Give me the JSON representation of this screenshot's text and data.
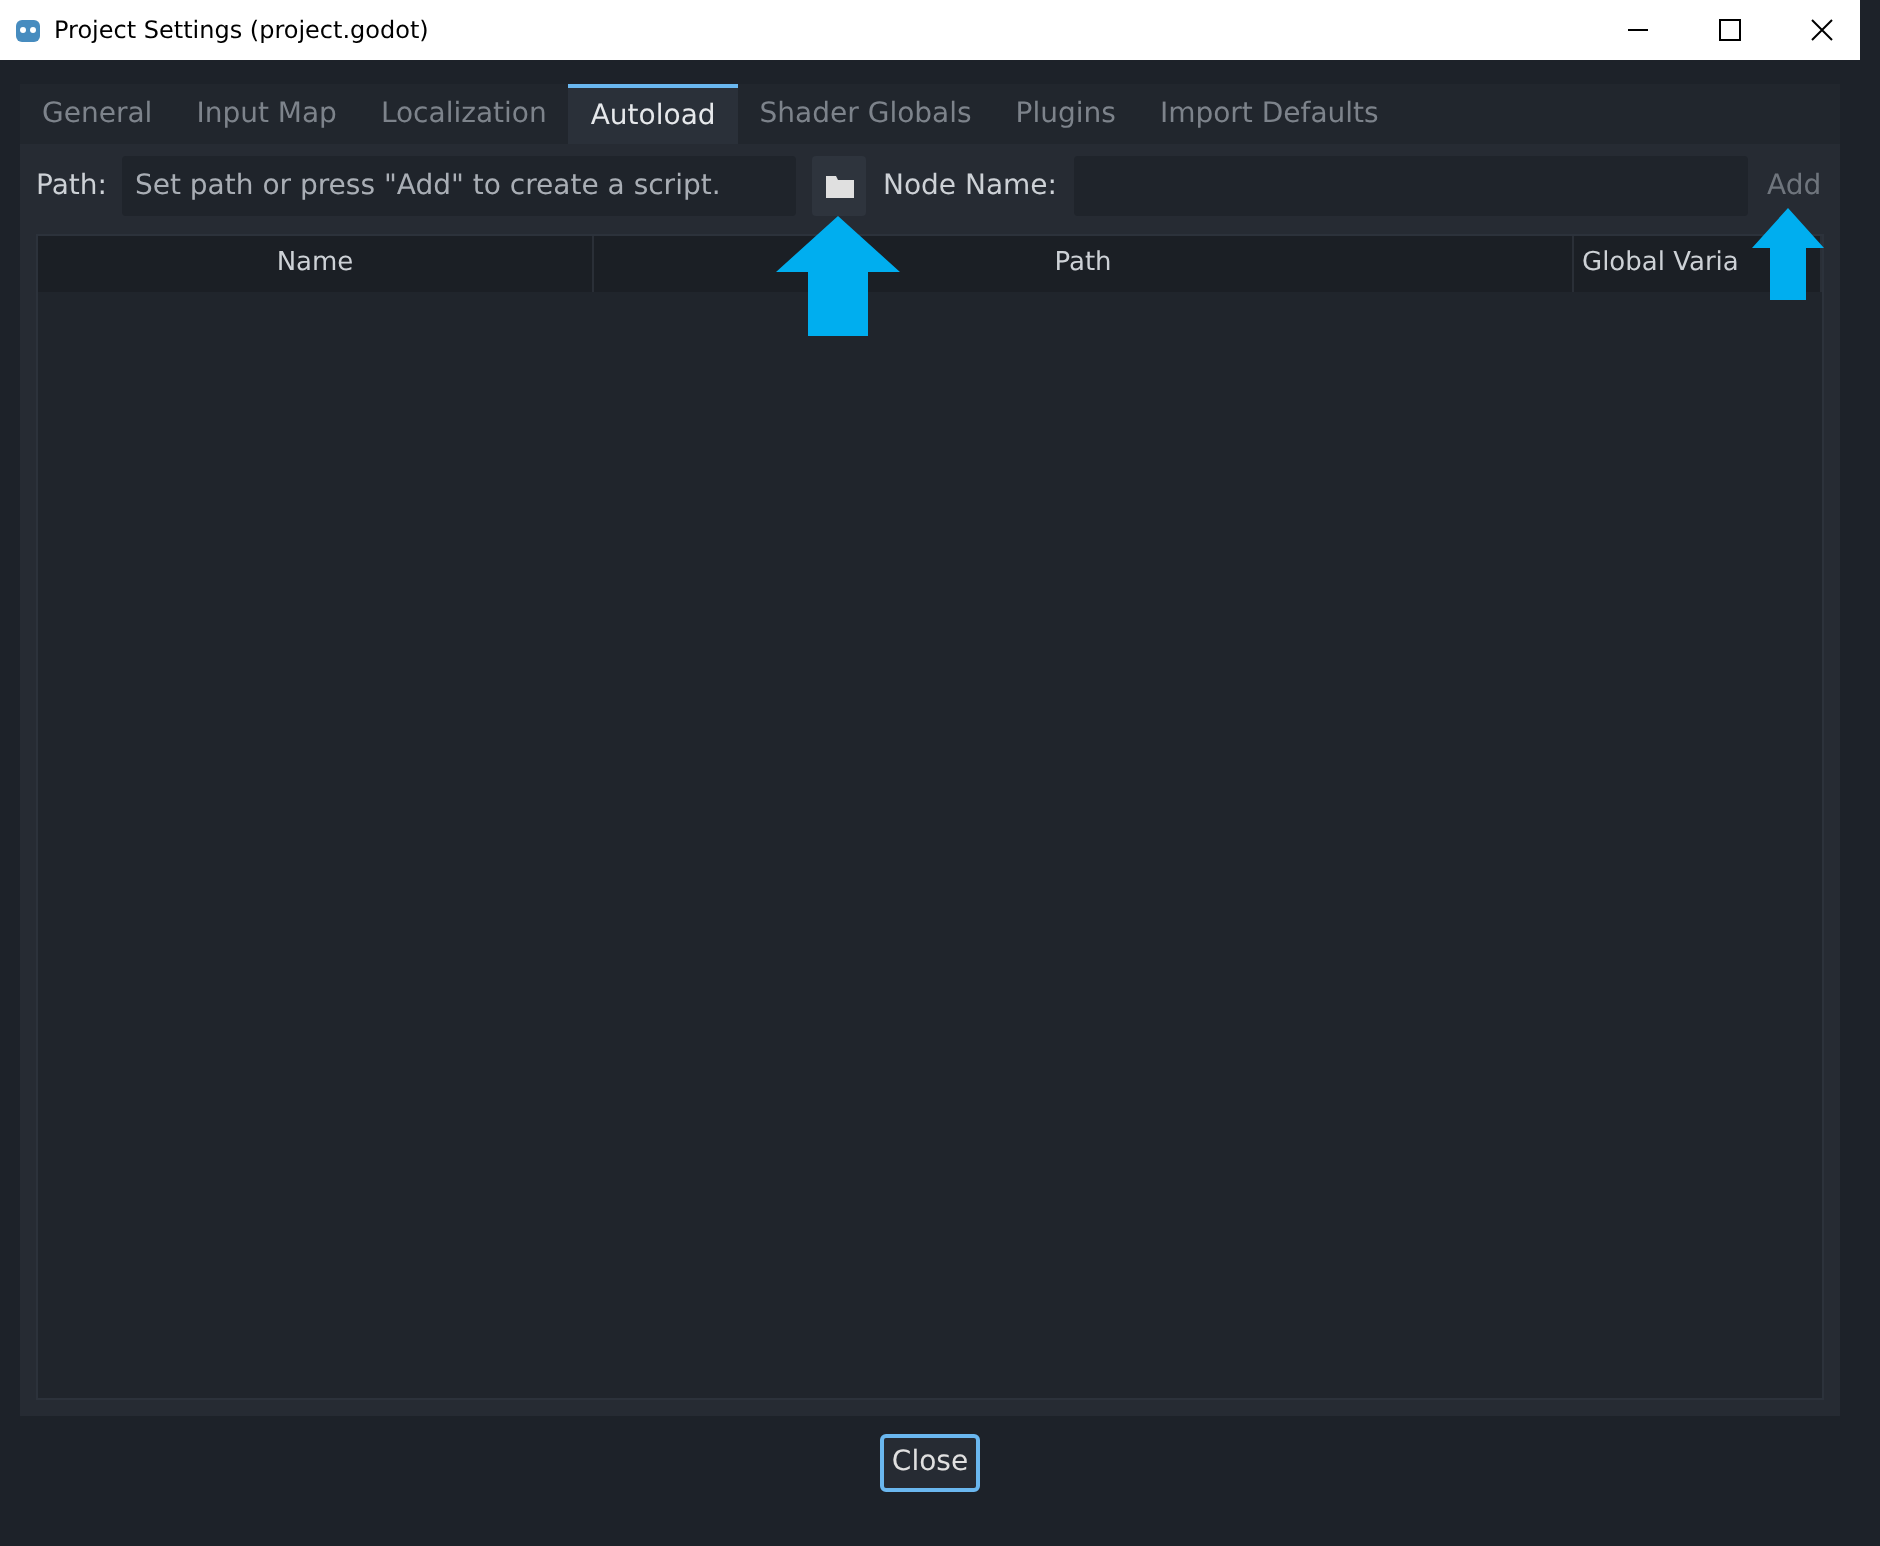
{
  "window": {
    "title": "Project Settings (project.godot)"
  },
  "tabs": [
    {
      "label": "General",
      "selected": false
    },
    {
      "label": "Input Map",
      "selected": false
    },
    {
      "label": "Localization",
      "selected": false
    },
    {
      "label": "Autoload",
      "selected": true
    },
    {
      "label": "Shader Globals",
      "selected": false
    },
    {
      "label": "Plugins",
      "selected": false
    },
    {
      "label": "Import Defaults",
      "selected": false
    }
  ],
  "path": {
    "label": "Path:",
    "placeholder": "Set path or press \"Add\" to create a script."
  },
  "node_name": {
    "label": "Node Name:"
  },
  "add_button": {
    "label": "Add",
    "disabled": true
  },
  "table": {
    "columns": [
      "Name",
      "Path",
      "Global Varia"
    ]
  },
  "buttons": [
    "Close"
  ]
}
